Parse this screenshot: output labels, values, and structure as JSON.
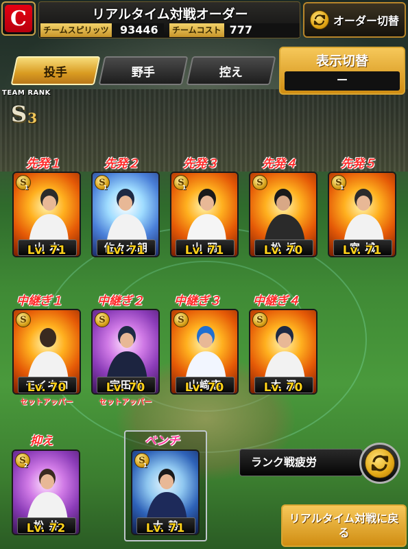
{
  "header": {
    "title": "リアルタイム対戦オーダー",
    "team_spirit_label": "チームスピリッツ",
    "team_spirit_value": "93446",
    "team_cost_label": "チームコスト",
    "team_cost_value": "777",
    "logo_letter": "C",
    "order_switch_label": "オーダー切替"
  },
  "tabs": [
    {
      "label": "投手",
      "active": true
    },
    {
      "label": "野手",
      "active": false
    },
    {
      "label": "控え",
      "active": false
    }
  ],
  "display_switch": {
    "title": "表示切替",
    "value": "－"
  },
  "team_rank": {
    "label": "TEAM RANK",
    "letter": "S",
    "digit": "3"
  },
  "starters": [
    {
      "position": "先発１",
      "name": "山 本",
      "level": "Lv. 71",
      "badge_num": "1"
    },
    {
      "position": "先発２",
      "name": "佐々木朗",
      "level": "Lv. 71",
      "badge_num": "1"
    },
    {
      "position": "先発３",
      "name": "山 岡",
      "level": "Lv. 71",
      "badge_num": "1"
    },
    {
      "position": "先発４",
      "name": "松 坂",
      "level": "Lv. 70",
      "badge_num": ""
    },
    {
      "position": "先発５",
      "name": "宮 城",
      "level": "Lv. 71",
      "badge_num": "1"
    }
  ],
  "relievers": [
    {
      "position": "中継ぎ１",
      "name": "モイネロ",
      "level": "Lv. 70",
      "role": "セットアッパー"
    },
    {
      "position": "中継ぎ２",
      "name": "宇田川",
      "level": "Lv. 70",
      "role": "セットアッパー"
    },
    {
      "position": "中継ぎ３",
      "name": "山﨑康",
      "level": "Lv. 70",
      "role": ""
    },
    {
      "position": "中継ぎ４",
      "name": "木 澤",
      "level": "Lv. 70",
      "role": ""
    }
  ],
  "closer": {
    "position": "抑え",
    "name": "松 井",
    "level": "Lv. 72",
    "badge_num": "2"
  },
  "bench": {
    "position": "ベンチ",
    "name": "大 勢",
    "level": "Lv. 71",
    "badge_num": "1"
  },
  "fatigue_label": "ランク戦疲労",
  "back_button_label": "リアルタイム対戦に戻る",
  "colors": {
    "accent_gold": "#d99b21",
    "position_red": "#ff2a2a",
    "level_yellow": "#ffd21a"
  }
}
